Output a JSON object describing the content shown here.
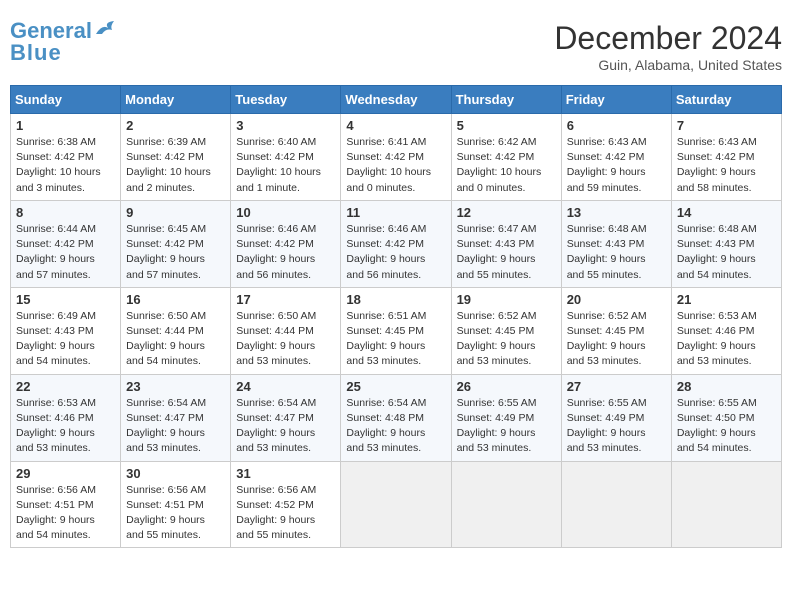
{
  "header": {
    "logo_general": "General",
    "logo_blue": "Blue",
    "month": "December 2024",
    "location": "Guin, Alabama, United States"
  },
  "days_of_week": [
    "Sunday",
    "Monday",
    "Tuesday",
    "Wednesday",
    "Thursday",
    "Friday",
    "Saturday"
  ],
  "weeks": [
    [
      {
        "day": "1",
        "sunrise": "Sunrise: 6:38 AM",
        "sunset": "Sunset: 4:42 PM",
        "daylight": "Daylight: 10 hours and 3 minutes."
      },
      {
        "day": "2",
        "sunrise": "Sunrise: 6:39 AM",
        "sunset": "Sunset: 4:42 PM",
        "daylight": "Daylight: 10 hours and 2 minutes."
      },
      {
        "day": "3",
        "sunrise": "Sunrise: 6:40 AM",
        "sunset": "Sunset: 4:42 PM",
        "daylight": "Daylight: 10 hours and 1 minute."
      },
      {
        "day": "4",
        "sunrise": "Sunrise: 6:41 AM",
        "sunset": "Sunset: 4:42 PM",
        "daylight": "Daylight: 10 hours and 0 minutes."
      },
      {
        "day": "5",
        "sunrise": "Sunrise: 6:42 AM",
        "sunset": "Sunset: 4:42 PM",
        "daylight": "Daylight: 10 hours and 0 minutes."
      },
      {
        "day": "6",
        "sunrise": "Sunrise: 6:43 AM",
        "sunset": "Sunset: 4:42 PM",
        "daylight": "Daylight: 9 hours and 59 minutes."
      },
      {
        "day": "7",
        "sunrise": "Sunrise: 6:43 AM",
        "sunset": "Sunset: 4:42 PM",
        "daylight": "Daylight: 9 hours and 58 minutes."
      }
    ],
    [
      {
        "day": "8",
        "sunrise": "Sunrise: 6:44 AM",
        "sunset": "Sunset: 4:42 PM",
        "daylight": "Daylight: 9 hours and 57 minutes."
      },
      {
        "day": "9",
        "sunrise": "Sunrise: 6:45 AM",
        "sunset": "Sunset: 4:42 PM",
        "daylight": "Daylight: 9 hours and 57 minutes."
      },
      {
        "day": "10",
        "sunrise": "Sunrise: 6:46 AM",
        "sunset": "Sunset: 4:42 PM",
        "daylight": "Daylight: 9 hours and 56 minutes."
      },
      {
        "day": "11",
        "sunrise": "Sunrise: 6:46 AM",
        "sunset": "Sunset: 4:42 PM",
        "daylight": "Daylight: 9 hours and 56 minutes."
      },
      {
        "day": "12",
        "sunrise": "Sunrise: 6:47 AM",
        "sunset": "Sunset: 4:43 PM",
        "daylight": "Daylight: 9 hours and 55 minutes."
      },
      {
        "day": "13",
        "sunrise": "Sunrise: 6:48 AM",
        "sunset": "Sunset: 4:43 PM",
        "daylight": "Daylight: 9 hours and 55 minutes."
      },
      {
        "day": "14",
        "sunrise": "Sunrise: 6:48 AM",
        "sunset": "Sunset: 4:43 PM",
        "daylight": "Daylight: 9 hours and 54 minutes."
      }
    ],
    [
      {
        "day": "15",
        "sunrise": "Sunrise: 6:49 AM",
        "sunset": "Sunset: 4:43 PM",
        "daylight": "Daylight: 9 hours and 54 minutes."
      },
      {
        "day": "16",
        "sunrise": "Sunrise: 6:50 AM",
        "sunset": "Sunset: 4:44 PM",
        "daylight": "Daylight: 9 hours and 54 minutes."
      },
      {
        "day": "17",
        "sunrise": "Sunrise: 6:50 AM",
        "sunset": "Sunset: 4:44 PM",
        "daylight": "Daylight: 9 hours and 53 minutes."
      },
      {
        "day": "18",
        "sunrise": "Sunrise: 6:51 AM",
        "sunset": "Sunset: 4:45 PM",
        "daylight": "Daylight: 9 hours and 53 minutes."
      },
      {
        "day": "19",
        "sunrise": "Sunrise: 6:52 AM",
        "sunset": "Sunset: 4:45 PM",
        "daylight": "Daylight: 9 hours and 53 minutes."
      },
      {
        "day": "20",
        "sunrise": "Sunrise: 6:52 AM",
        "sunset": "Sunset: 4:45 PM",
        "daylight": "Daylight: 9 hours and 53 minutes."
      },
      {
        "day": "21",
        "sunrise": "Sunrise: 6:53 AM",
        "sunset": "Sunset: 4:46 PM",
        "daylight": "Daylight: 9 hours and 53 minutes."
      }
    ],
    [
      {
        "day": "22",
        "sunrise": "Sunrise: 6:53 AM",
        "sunset": "Sunset: 4:46 PM",
        "daylight": "Daylight: 9 hours and 53 minutes."
      },
      {
        "day": "23",
        "sunrise": "Sunrise: 6:54 AM",
        "sunset": "Sunset: 4:47 PM",
        "daylight": "Daylight: 9 hours and 53 minutes."
      },
      {
        "day": "24",
        "sunrise": "Sunrise: 6:54 AM",
        "sunset": "Sunset: 4:47 PM",
        "daylight": "Daylight: 9 hours and 53 minutes."
      },
      {
        "day": "25",
        "sunrise": "Sunrise: 6:54 AM",
        "sunset": "Sunset: 4:48 PM",
        "daylight": "Daylight: 9 hours and 53 minutes."
      },
      {
        "day": "26",
        "sunrise": "Sunrise: 6:55 AM",
        "sunset": "Sunset: 4:49 PM",
        "daylight": "Daylight: 9 hours and 53 minutes."
      },
      {
        "day": "27",
        "sunrise": "Sunrise: 6:55 AM",
        "sunset": "Sunset: 4:49 PM",
        "daylight": "Daylight: 9 hours and 53 minutes."
      },
      {
        "day": "28",
        "sunrise": "Sunrise: 6:55 AM",
        "sunset": "Sunset: 4:50 PM",
        "daylight": "Daylight: 9 hours and 54 minutes."
      }
    ],
    [
      {
        "day": "29",
        "sunrise": "Sunrise: 6:56 AM",
        "sunset": "Sunset: 4:51 PM",
        "daylight": "Daylight: 9 hours and 54 minutes."
      },
      {
        "day": "30",
        "sunrise": "Sunrise: 6:56 AM",
        "sunset": "Sunset: 4:51 PM",
        "daylight": "Daylight: 9 hours and 55 minutes."
      },
      {
        "day": "31",
        "sunrise": "Sunrise: 6:56 AM",
        "sunset": "Sunset: 4:52 PM",
        "daylight": "Daylight: 9 hours and 55 minutes."
      },
      null,
      null,
      null,
      null
    ]
  ]
}
